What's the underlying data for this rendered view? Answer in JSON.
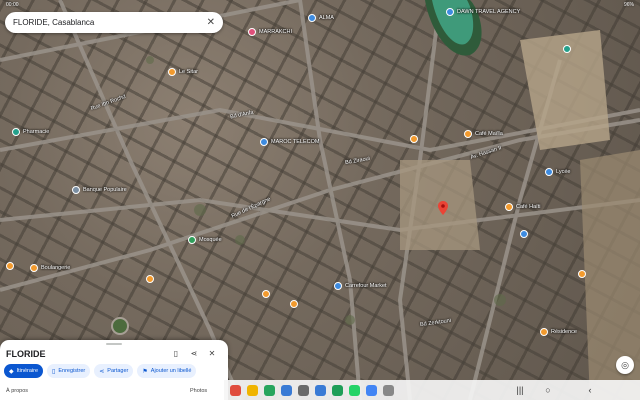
{
  "status_bar": {
    "time": "00:00",
    "battery": "96%"
  },
  "search": {
    "query": "FLORIDE, Casablanca"
  },
  "roads": [
    {
      "name": "Bd d'Anfa"
    },
    {
      "name": "Rue Ibn Rochd"
    },
    {
      "name": "Bd Ziraoui"
    },
    {
      "name": "Rue de l'Épargne"
    },
    {
      "name": "Av. Hassan II"
    },
    {
      "name": "Bd Zerktouni"
    }
  ],
  "pois": [
    {
      "label": "MARRAKCHI",
      "color": "#e0507a"
    },
    {
      "label": "ALMA",
      "color": "#3d8be0"
    },
    {
      "label": "Le Sitar",
      "color": "#f29a2e"
    },
    {
      "label": "DAWN TRAVEL AGENCY",
      "color": "#3d8be0"
    },
    {
      "label": "MAROC TELECOM",
      "color": "#3d8be0"
    },
    {
      "label": "Café Maïlla",
      "color": "#f29a2e"
    },
    {
      "label": "Pharmacie",
      "color": "#24a08b"
    },
    {
      "label": "Mosquée",
      "color": "#2f9e5a"
    },
    {
      "label": "Carrefour Market",
      "color": "#3d8be0"
    },
    {
      "label": "Café Haïti",
      "color": "#f29a2e"
    },
    {
      "label": "Banque Populaire",
      "color": "#7b8fa3"
    },
    {
      "label": "Boulangerie",
      "color": "#f29a2e"
    },
    {
      "label": "Résidence",
      "color": "#f29a2e"
    },
    {
      "label": "Lycée",
      "color": "#3d8be0"
    }
  ],
  "sheet": {
    "title": "FLORIDE",
    "actions": {
      "itinerary": "Itinéraire",
      "save": "Enregistrer",
      "share": "Partager",
      "add_label": "Ajouter un libellé"
    },
    "about": "À propos",
    "tab2": "Photos"
  },
  "icons": {
    "close": "close-icon",
    "bookmark": "bookmark-icon",
    "share": "share-icon",
    "more": "more-icon"
  },
  "colors": {
    "accent": "#0b57d0",
    "pin": "#ea4335"
  }
}
